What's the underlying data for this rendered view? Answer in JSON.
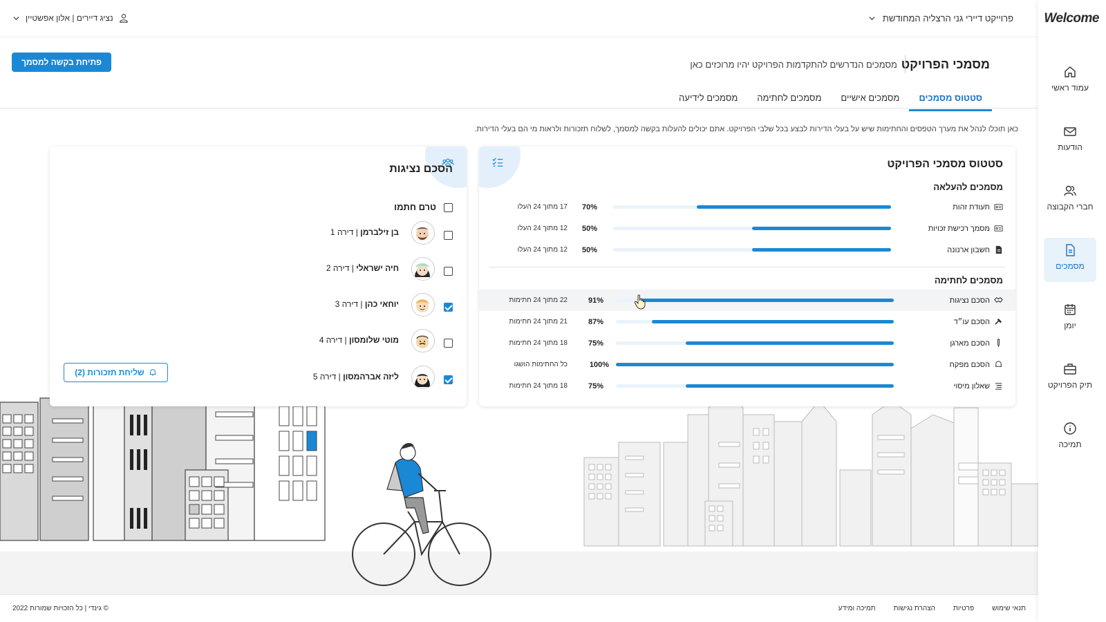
{
  "app": {
    "logo": "Welcome"
  },
  "sidebar": {
    "items": [
      {
        "label": "עמוד ראשי",
        "icon": "home-icon"
      },
      {
        "label": "הודעות",
        "icon": "mail-icon"
      },
      {
        "label": "חברי הקבוצה",
        "icon": "users-icon"
      },
      {
        "label": "מסמכים",
        "icon": "document-icon",
        "active": true
      },
      {
        "label": "יומן",
        "icon": "calendar-icon"
      },
      {
        "label": "תיק הפרויקט",
        "icon": "briefcase-icon"
      },
      {
        "label": "תמיכה",
        "icon": "info-icon"
      }
    ]
  },
  "header": {
    "project": "פרוייקט דיירי גני הרצליה המחודשת",
    "user": "נציג דיירים | אלון אפשטיין"
  },
  "page": {
    "title": "מסמכי הפרויקט",
    "subtitle": "מסמכים הנדרשים להתקדמות הפרויקט יהיו מרוכזים כאן",
    "open_request_button": "פתיחת בקשה למסמך",
    "tabs": [
      "סטטוס מסמכים",
      "מסמכים אישיים",
      "מסמכים לחתימה",
      "מסמכים לידיעה"
    ],
    "intro": "כאן תוכלו לנהל את מערך הטפסים והחתימות שיש על בעלי הדירות לבצע בכל שלבי הפרויקט. אתם יכולים להעלות בקשה למסמך, לשלוח תזכורות ולראות מי הם בעלי הדירות."
  },
  "status_card": {
    "title": "סטטוס מסמכי הפרויקט",
    "upload_section": "מסמכים להעלאה",
    "upload_docs": [
      {
        "name": "תעודת זהות",
        "pct": "70%",
        "value": 0.7,
        "meta": "17 מתוך 24 העלו"
      },
      {
        "name": "מסמך רכישת זכויות",
        "pct": "50%",
        "value": 0.5,
        "meta": "12 מתוך 24 העלו"
      },
      {
        "name": "חשבון ארנונה",
        "pct": "50%",
        "value": 0.5,
        "meta": "12 מתוך 24 העלו"
      }
    ],
    "sign_section": "מסמכים לחתימה",
    "sign_docs": [
      {
        "name": "הסכם נציגות",
        "pct": "91%",
        "value": 0.91,
        "meta": "22 מתוך 24 חתימות"
      },
      {
        "name": "הסכם עו״ד",
        "pct": "87%",
        "value": 0.87,
        "meta": "21 מתוך 24 חתימות"
      },
      {
        "name": "הסכם מארגן",
        "pct": "75%",
        "value": 0.75,
        "meta": "18 מתוך 24 חתימות"
      },
      {
        "name": "הסכם מפקח",
        "pct": "100%",
        "value": 1.0,
        "meta": "כל החתימות הושגו"
      },
      {
        "name": "שאלון מיסוי",
        "pct": "75%",
        "value": 0.75,
        "meta": "18 מתוך 24 חתימות"
      }
    ]
  },
  "sign_card": {
    "title": "הסכם נציגות",
    "select_all": "טרם חתמו",
    "people": [
      {
        "name": "בן זילברמן",
        "apt": " | דירה 1",
        "checked": false
      },
      {
        "name": "חיה ישראלי",
        "apt": " | דירה 2",
        "checked": false
      },
      {
        "name": "יוחאי כהן",
        "apt": " | דירה 3",
        "checked": true
      },
      {
        "name": "מוטי שלומסון",
        "apt": " | דירה 4",
        "checked": false
      },
      {
        "name": "ליזה אברהמסון",
        "apt": " | דירה 5",
        "checked": true
      }
    ],
    "remind_button": "שליחת תזכורות (2)"
  },
  "footer": {
    "links": [
      "תנאי שימוש",
      "פרטיות",
      "הצהרת נגישות",
      "תמיכה ומידע"
    ],
    "copyright": "© גינדי | כל הזכויות שמורות 2022"
  },
  "colors": {
    "accent": "#1b88d6",
    "accent_light": "#e3f0fb"
  }
}
